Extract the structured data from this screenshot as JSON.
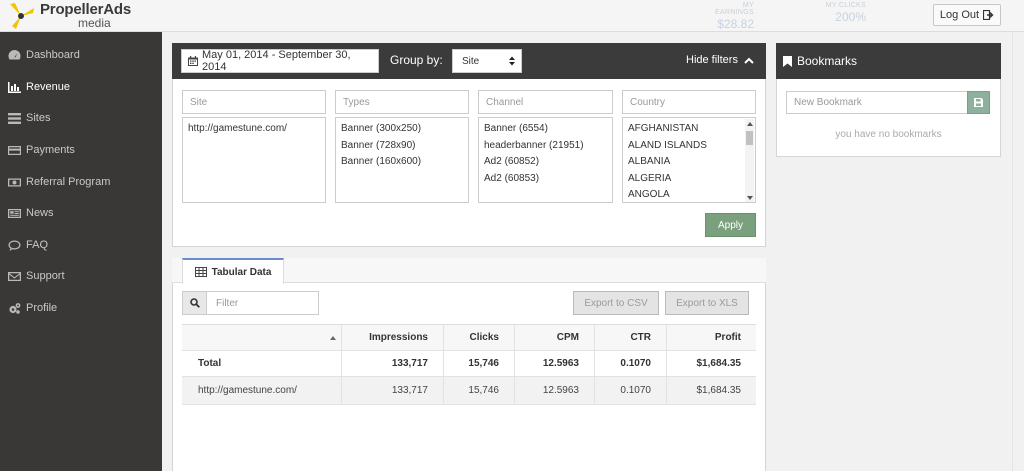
{
  "header": {
    "logo_primary": "PropellerAds",
    "logo_secondary": "media",
    "stats": [
      {
        "label": "MY EARNINGS",
        "value": "$28.82"
      },
      {
        "label": "MY CLICKS",
        "value": "200%"
      }
    ],
    "logout_label": "Log Out"
  },
  "sidebar": {
    "items": [
      {
        "label": "Dashboard",
        "icon": "dashboard-icon",
        "active": false
      },
      {
        "label": "Revenue",
        "icon": "bar-chart-icon",
        "active": true
      },
      {
        "label": "Sites",
        "icon": "list-icon",
        "active": false
      },
      {
        "label": "Payments",
        "icon": "credit-card-icon",
        "active": false
      },
      {
        "label": "Referral Program",
        "icon": "money-icon",
        "active": false
      },
      {
        "label": "News",
        "icon": "newspaper-icon",
        "active": false
      },
      {
        "label": "FAQ",
        "icon": "comment-icon",
        "active": false
      },
      {
        "label": "Support",
        "icon": "envelope-icon",
        "active": false
      },
      {
        "label": "Profile",
        "icon": "gears-icon",
        "active": false
      }
    ]
  },
  "filters": {
    "date_range": "May 01, 2014 - September 30, 2014",
    "group_by_label": "Group by:",
    "group_by_value": "Site",
    "hide_filters_label": "Hide filters",
    "apply_label": "Apply",
    "boxes": [
      {
        "placeholder": "Site",
        "options": [
          "http://gamestune.com/"
        ]
      },
      {
        "placeholder": "Types",
        "options": [
          "Banner (300x250)",
          "Banner (728x90)",
          "Banner (160x600)"
        ]
      },
      {
        "placeholder": "Channel",
        "options": [
          "Banner (6554)",
          "headerbanner (21951)",
          "Ad2 (60852)",
          "Ad2 (60853)"
        ]
      },
      {
        "placeholder": "Country",
        "options": [
          "AFGHANISTAN",
          "ALAND ISLANDS",
          "ALBANIA",
          "ALGERIA",
          "ANGOLA"
        ]
      }
    ]
  },
  "tabular": {
    "tab_label": "Tabular Data",
    "filter_placeholder": "Filter",
    "export_csv_label": "Export to CSV",
    "export_xls_label": "Export to XLS",
    "columns": [
      "",
      "Impressions",
      "Clicks",
      "CPM",
      "CTR",
      "Profit"
    ],
    "total_row": [
      "Total",
      "133,717",
      "15,746",
      "12.5963",
      "0.1070",
      "$1,684.35"
    ],
    "rows": [
      [
        "http://gamestune.com/",
        "133,717",
        "15,746",
        "12.5963",
        "0.1070",
        "$1,684.35"
      ]
    ]
  },
  "bookmarks": {
    "title": "Bookmarks",
    "input_placeholder": "New Bookmark",
    "empty_text": "you have no bookmarks"
  },
  "colors": {
    "sidebar_bg": "#3a3836",
    "panel_header_bg": "#3b3b3b",
    "apply_green": "#7aa07e",
    "tab_accent": "#6b8ad0"
  }
}
